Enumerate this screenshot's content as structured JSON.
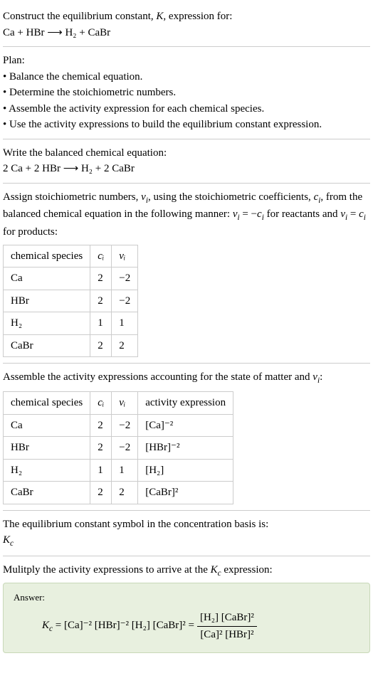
{
  "prompt": {
    "line1_pre": "Construct the equilibrium constant, ",
    "line1_K": "K",
    "line1_post": ", expression for:",
    "eq": "Ca + HBr ⟶ H₂ + CaBr"
  },
  "plan": {
    "title": "Plan:",
    "b1": "• Balance the chemical equation.",
    "b2": "• Determine the stoichiometric numbers.",
    "b3": "• Assemble the activity expression for each chemical species.",
    "b4": "• Use the activity expressions to build the equilibrium constant expression."
  },
  "balanced": {
    "title": "Write the balanced chemical equation:",
    "eq": "2 Ca + 2 HBr ⟶ H₂ + 2 CaBr"
  },
  "stoich_text": {
    "a": "Assign stoichiometric numbers, ",
    "nu": "ν",
    "nu_sub": "i",
    "b": ", using the stoichiometric coefficients, ",
    "c": "c",
    "c_sub": "i",
    "d": ", from the balanced chemical equation in the following manner: ",
    "rel1a": "ν",
    "rel1b": "i",
    "rel1c": " = −",
    "rel1d": "c",
    "rel1e": "i",
    "e": " for reactants and ",
    "rel2a": "ν",
    "rel2b": "i",
    "rel2c": " = ",
    "rel2d": "c",
    "rel2e": "i",
    "f": " for products:"
  },
  "table1": {
    "h1": "chemical species",
    "h2": "cᵢ",
    "h3": "νᵢ",
    "rows": [
      {
        "s": "Ca",
        "c": "2",
        "n": "−2"
      },
      {
        "s": "HBr",
        "c": "2",
        "n": "−2"
      },
      {
        "s": "H₂",
        "c": "1",
        "n": "1"
      },
      {
        "s": "CaBr",
        "c": "2",
        "n": "2"
      }
    ]
  },
  "assemble": {
    "a": "Assemble the activity expressions accounting for the state of matter and ",
    "nu": "ν",
    "nu_sub": "i",
    "b": ":"
  },
  "table2": {
    "h1": "chemical species",
    "h2": "cᵢ",
    "h3": "νᵢ",
    "h4": "activity expression",
    "rows": [
      {
        "s": "Ca",
        "c": "2",
        "n": "−2",
        "a": "[Ca]⁻²"
      },
      {
        "s": "HBr",
        "c": "2",
        "n": "−2",
        "a": "[HBr]⁻²"
      },
      {
        "s": "H₂",
        "c": "1",
        "n": "1",
        "a": "[H₂]"
      },
      {
        "s": "CaBr",
        "c": "2",
        "n": "2",
        "a": "[CaBr]²"
      }
    ]
  },
  "kc_symbol": {
    "a": "The equilibrium constant symbol in the concentration basis is:",
    "k": "K",
    "sub": "c"
  },
  "multiply": {
    "a": "Mulitply the activity expressions to arrive at the ",
    "k": "K",
    "sub": "c",
    "b": " expression:"
  },
  "answer": {
    "label": "Answer:",
    "k": "K",
    "sub": "c",
    "eq": " = [Ca]⁻² [HBr]⁻² [H₂] [CaBr]² = ",
    "num": "[H₂] [CaBr]²",
    "den": "[Ca]² [HBr]²"
  }
}
